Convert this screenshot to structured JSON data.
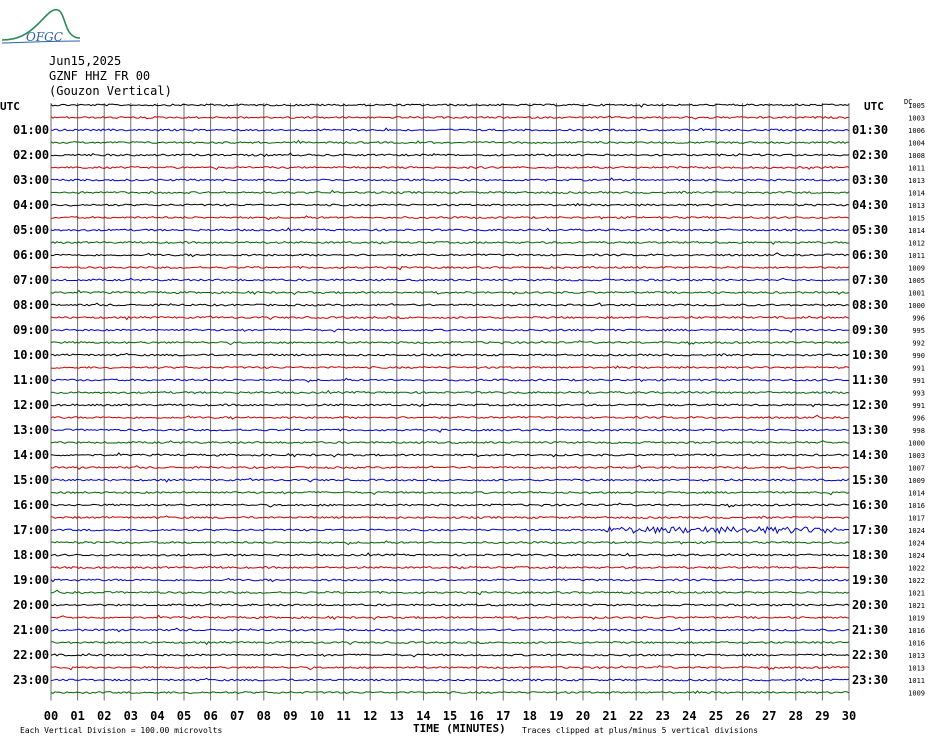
{
  "logo": {
    "text": "OFGC"
  },
  "header": {
    "date": "Jun15,2025",
    "channel": "GZNF HHZ FR 00",
    "station": "(Gouzon Vertical)"
  },
  "chart_data": {
    "type": "line",
    "subtype": "helicorder",
    "left_axis_label": "UTC",
    "right_axis_label": "UTC",
    "corner_label": "DC",
    "left_time_labels": [
      "01:00",
      "02:00",
      "03:00",
      "04:00",
      "05:00",
      "06:00",
      "07:00",
      "08:00",
      "09:00",
      "10:00",
      "11:00",
      "12:00",
      "13:00",
      "14:00",
      "15:00",
      "16:00",
      "17:00",
      "18:00",
      "19:00",
      "20:00",
      "21:00",
      "22:00",
      "23:00"
    ],
    "right_time_labels": [
      "01:30",
      "02:30",
      "03:30",
      "04:30",
      "05:30",
      "06:30",
      "07:30",
      "08:30",
      "09:30",
      "10:30",
      "11:30",
      "12:30",
      "13:30",
      "14:30",
      "15:30",
      "16:30",
      "17:30",
      "18:30",
      "19:30",
      "20:30",
      "21:30",
      "22:30",
      "23:30"
    ],
    "dc_offsets": [
      1005,
      1003,
      1006,
      1004,
      1008,
      1011,
      1013,
      1014,
      1013,
      1015,
      1014,
      1012,
      1011,
      1009,
      1005,
      1001,
      1000,
      996,
      995,
      992,
      990,
      991,
      991,
      993,
      991,
      996,
      998,
      1000,
      1003,
      1007,
      1009,
      1014,
      1016,
      1017,
      1024,
      1024,
      1024,
      1022,
      1022,
      1021,
      1021,
      1019,
      1016,
      1016,
      1013,
      1013,
      1011,
      1009
    ],
    "trace_colors": [
      "#000000",
      "#cc0000",
      "#0000cc",
      "#006600"
    ],
    "traces_per_hour": 2,
    "trace_count": 48,
    "trace_minutes": 30,
    "x_ticks": [
      "00",
      "01",
      "02",
      "03",
      "04",
      "05",
      "06",
      "07",
      "08",
      "09",
      "10",
      "11",
      "12",
      "13",
      "14",
      "15",
      "16",
      "17",
      "18",
      "19",
      "20",
      "21",
      "22",
      "23",
      "24",
      "25",
      "26",
      "27",
      "28",
      "29",
      "30"
    ],
    "xlabel": "TIME (MINUTES)",
    "xlim": [
      0,
      30
    ],
    "grid": true,
    "footer_left": "Each Vertical Division =  100.00 microvolts",
    "footer_right": "Traces clipped at plus/minus 5 vertical divisions",
    "highlight_event": {
      "trace_index": 34,
      "start_minute": 20.8,
      "end_minute": 29.5
    }
  }
}
